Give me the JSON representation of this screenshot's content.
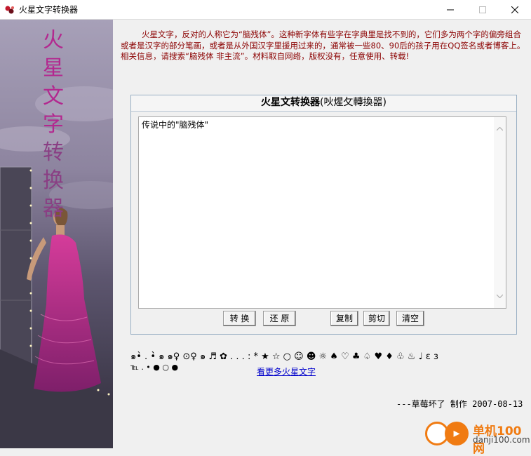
{
  "window": {
    "title": "火星文字转换器",
    "controls": {
      "minimize": "minimize-icon",
      "maximize": "maximize-icon",
      "close": "close-icon"
    }
  },
  "sidebar": {
    "chars": [
      "火",
      "星",
      "文",
      "字",
      "转",
      "换",
      "器"
    ]
  },
  "intro": {
    "text": "火星文字，反对的人称它为“脑残体”。这种新字体有些字在字典里是找不到的，它们多为两个字的偏旁组合或者是汉字的部分笔画，或者是从外国汉字里援用过来的，通常被一些80、90后的孩子用在QQ签名或者博客上。 相关信息，请搜索“脑残体 非主流”。材料取自网络，版权没有，任意使用、转载!"
  },
  "converter": {
    "title_main": "火星文转换器",
    "title_alt": "(吙煋攵轉換噐)",
    "text_value": "传说中的\"脑残体\"",
    "buttons": {
      "convert": "转 换",
      "restore": "还 原",
      "copy": "复制",
      "cut": "剪切",
      "clear": "清空"
    }
  },
  "symbols": {
    "row1": "๑•̀ . •̀̀ ๑ ๑♀ ⊙♀ ๑ ♬ ✿ . . . : * ★ ☆ ○ ☺ ☻ ☼ ♠ ♡ ♣ ♤ ♥ ♦ ♧ ♨ ♩ ε з",
    "row2": "℡ . • ● ○ ●",
    "more_link": "看更多火星文字"
  },
  "credit": "---草莓坏了 制作 2007-08-13",
  "watermark": {
    "name": "单机100网",
    "url": "danji100.com"
  },
  "colors": {
    "intro_text": "#8b0000",
    "link": "#0000cc",
    "side_title": "#b3288f",
    "watermark": "#f07b12"
  }
}
